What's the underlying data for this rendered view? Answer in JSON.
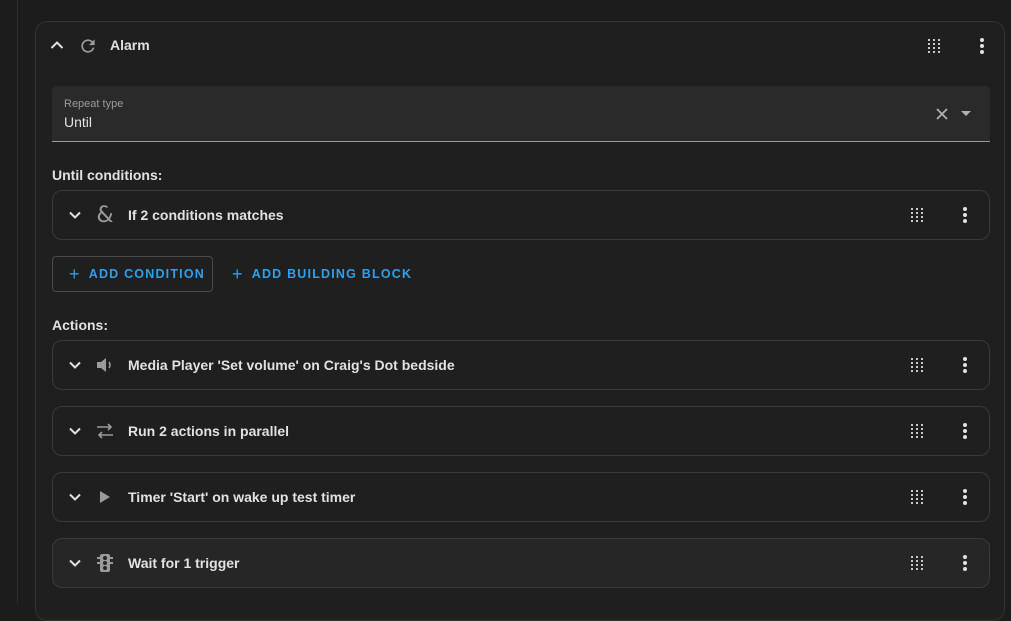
{
  "block": {
    "title": "Alarm",
    "repeat_type_label": "Repeat type",
    "repeat_type_value": "Until"
  },
  "until_section": {
    "label": "Until conditions:",
    "conditions": [
      {
        "label": "If 2 conditions matches",
        "icon": "ampersand-icon"
      }
    ],
    "add_condition_label": "ADD CONDITION",
    "add_building_block_label": "ADD BUILDING BLOCK"
  },
  "actions_section": {
    "label": "Actions:",
    "actions": [
      {
        "label": "Media Player 'Set volume' on Craig's Dot bedside",
        "icon": "speaker-icon"
      },
      {
        "label": "Run 2 actions in parallel",
        "icon": "parallel-arrows-icon"
      },
      {
        "label": "Timer 'Start' on wake up test timer",
        "icon": "play-icon"
      },
      {
        "label": "Wait for 1 trigger",
        "icon": "traffic-light-icon"
      }
    ]
  },
  "colors": {
    "background": "#1c1c1c",
    "card": "#1f1f1f",
    "accent": "#2ea0ee",
    "text": "#e1e1e1",
    "muted": "#9b9b9b"
  }
}
